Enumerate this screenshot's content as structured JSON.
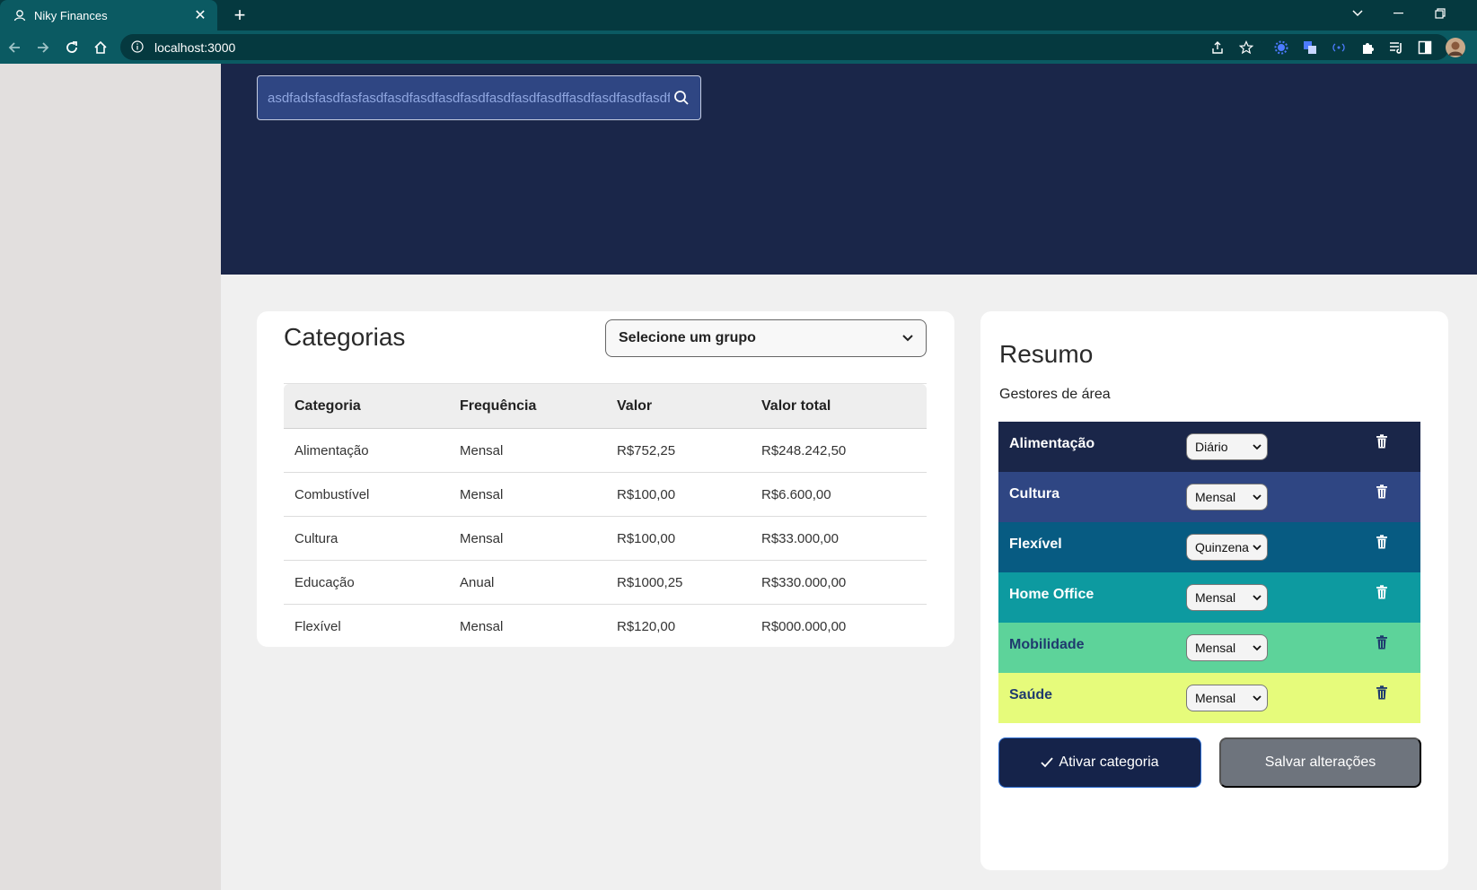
{
  "browser": {
    "tab_title": "Niky Finances",
    "tab_close": "✕",
    "new_tab": "+",
    "url": "localhost:3000"
  },
  "search": {
    "value": "asdfadsfasdfasfasdfasdfasdfasdfasdfasdfasdfasdffasdfasdfasdfasdfasdf"
  },
  "categories": {
    "title": "Categorias",
    "group_select": "Selecione um grupo",
    "columns": [
      "Categoria",
      "Frequência",
      "Valor",
      "Valor total"
    ],
    "rows": [
      [
        "Alimentação",
        "Mensal",
        "R$752,25",
        "R$248.242,50"
      ],
      [
        "Combustível",
        "Mensal",
        "R$100,00",
        "R$6.600,00"
      ],
      [
        "Cultura",
        "Mensal",
        "R$100,00",
        "R$33.000,00"
      ],
      [
        "Educação",
        "Anual",
        "R$1000,25",
        "R$330.000,00"
      ],
      [
        "Flexível",
        "Mensal",
        "R$120,00",
        "R$000.000,00"
      ]
    ]
  },
  "summary": {
    "title": "Resumo",
    "subtitle": "Gestores de área",
    "items": [
      {
        "name": "Alimentação",
        "frequency": "Diário",
        "bg": "#1a2649",
        "fg": "#ffffff"
      },
      {
        "name": "Cultura",
        "frequency": "Mensal",
        "bg": "#2f4683",
        "fg": "#ffffff"
      },
      {
        "name": "Flexível",
        "frequency": "Quinzenal",
        "bg": "#075b82",
        "fg": "#ffffff"
      },
      {
        "name": "Home Office",
        "frequency": "Mensal",
        "bg": "#0d9aa0",
        "fg": "#ffffff"
      },
      {
        "name": "Mobilidade",
        "frequency": "Mensal",
        "bg": "#5dd39a",
        "fg": "#1f3a6e"
      },
      {
        "name": "Saúde",
        "frequency": "Mensal",
        "bg": "#e6fb7b",
        "fg": "#1f3a6e"
      }
    ],
    "activate_label": "Ativar categoria",
    "save_label": "Salvar alterações"
  },
  "colors": {
    "hero": "#1a2649",
    "search_bg": "#2f4683",
    "browser_toolbar": "#0b5a62",
    "browser_tabbar": "#05393f",
    "activate_button": "#15234a",
    "save_button": "#6e747d"
  },
  "icons": {
    "search": "search-icon",
    "trash": "trash-icon",
    "check": "check-icon"
  }
}
